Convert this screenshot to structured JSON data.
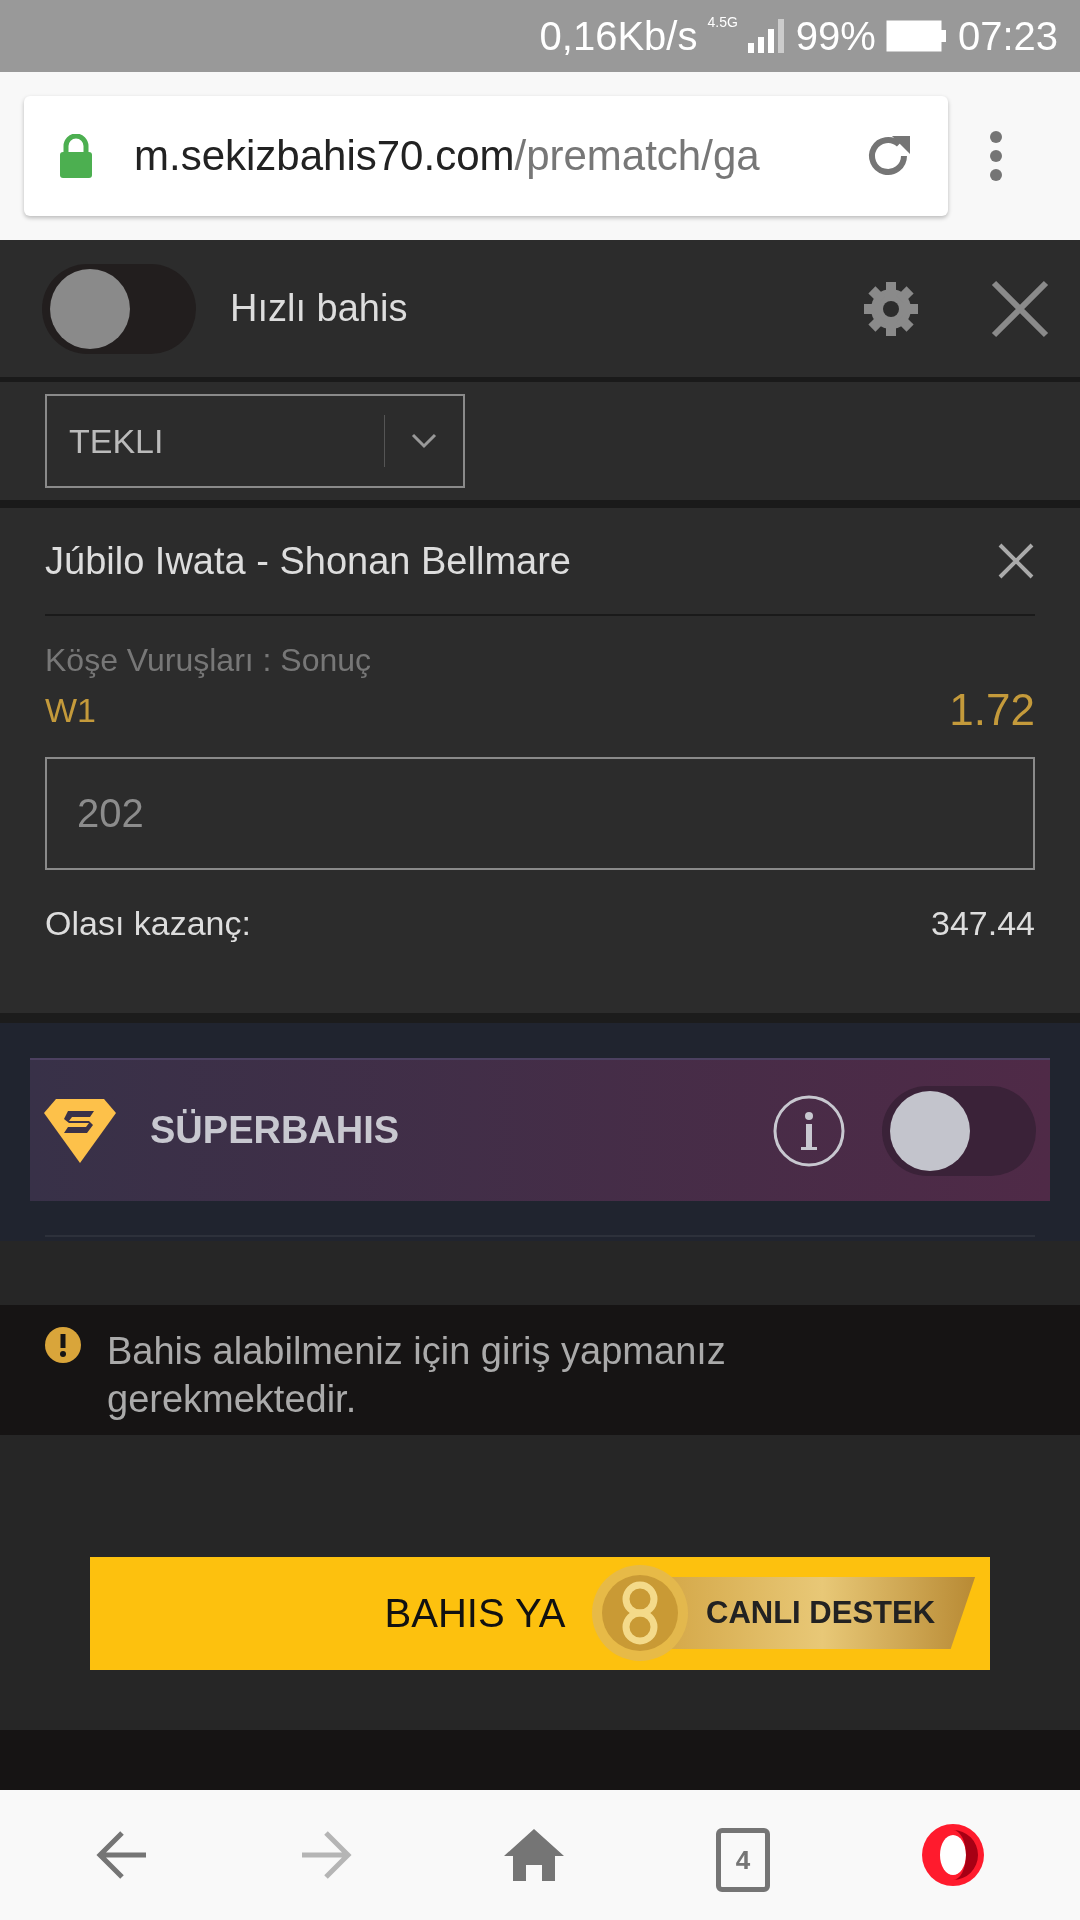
{
  "status_bar": {
    "speed": "0,16Kb/s",
    "network": "4.5G",
    "battery": "99%",
    "time": "07:23"
  },
  "address_bar": {
    "domain": "m.sekizbahis70.com",
    "path": "/prematch/ga"
  },
  "quick_bet": {
    "label": "Hızlı bahis",
    "on": false
  },
  "bet_type": {
    "value": "TEKLI"
  },
  "bet": {
    "match": "Júbilo Iwata - Shonan Bellmare",
    "market": "Köşe Vuruşları : Sonuç",
    "pick": "W1",
    "odds": "1.72",
    "stake": "202",
    "payout_label": "Olası kazanç:",
    "payout": "347.44"
  },
  "superbahis": {
    "label": "SÜPERBAHIS",
    "on": false
  },
  "notice": "Bahis alabilmeniz için giriş yapmanız gerekmektedir.",
  "place_bet_button": "BAHIS YA",
  "live_support_badge": "CANLI DESTEK",
  "bottom_nav": {
    "tab_count": "4"
  }
}
